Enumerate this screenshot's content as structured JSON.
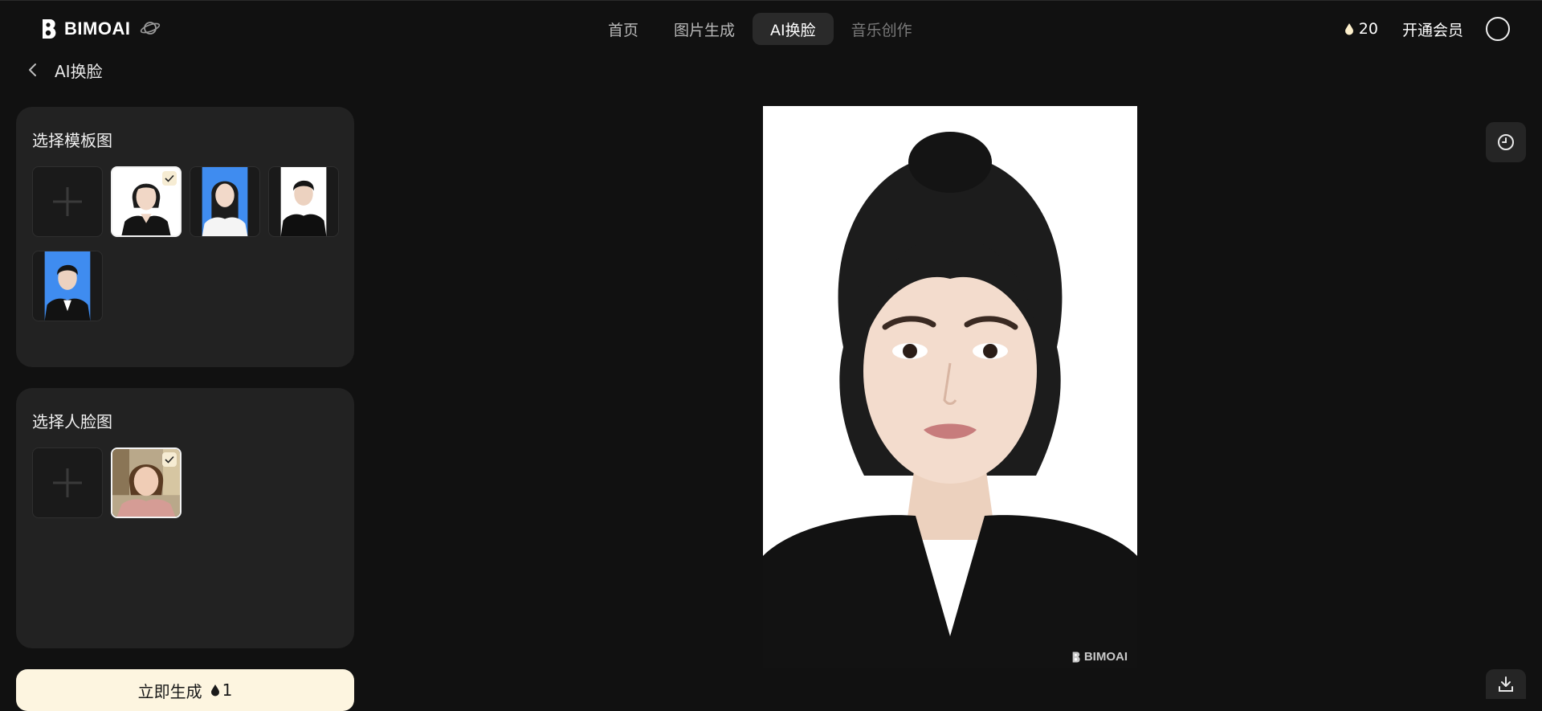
{
  "brand": {
    "name": "BIMOAI",
    "watermark": "BIMOAI"
  },
  "nav": {
    "items": [
      {
        "label": "首页"
      },
      {
        "label": "图片生成"
      },
      {
        "label": "AI换脸"
      },
      {
        "label": "音乐创作"
      }
    ],
    "active_index": 2
  },
  "account": {
    "credits": "20",
    "member_label": "开通会员"
  },
  "page": {
    "title": "AI换脸"
  },
  "template_panel": {
    "title": "选择模板图"
  },
  "face_panel": {
    "title": "选择人脸图"
  },
  "generate": {
    "label": "立即生成",
    "cost": "1"
  },
  "icons": {
    "logo": "bimoai-logo-icon",
    "planet": "planet-icon",
    "drop": "drop-icon",
    "back": "chevron-left-icon",
    "add": "plus-icon",
    "check": "check-icon",
    "history": "history-icon",
    "download": "download-icon"
  },
  "colors": {
    "background": "#111111",
    "panel": "#222222",
    "accent_cream": "#fdf5e0",
    "active_tab": "#2a2a2a",
    "photo_blue": "#3f8cf0"
  }
}
